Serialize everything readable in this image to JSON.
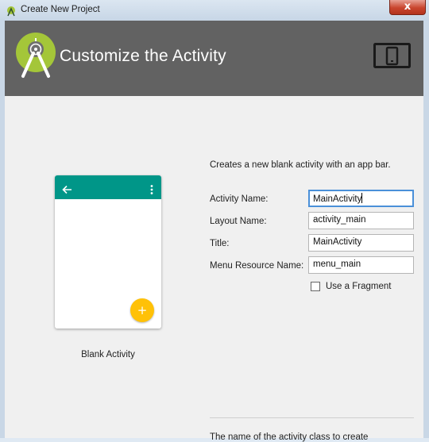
{
  "window": {
    "title": "Create New Project",
    "close_label": "x"
  },
  "header": {
    "title": "Customize the Activity",
    "brand_color": "#a4c639",
    "header_color": "#626262"
  },
  "preview": {
    "template_name": "Blank Activity",
    "appbar_color": "#009688",
    "fab_color": "#ffc107",
    "fab_label": "+"
  },
  "form": {
    "description": "Creates a new blank activity with an app bar.",
    "fields": [
      {
        "label": "Activity Name:",
        "value": "MainActivity"
      },
      {
        "label": "Layout Name:",
        "value": "activity_main"
      },
      {
        "label": "Title:",
        "value": "MainActivity"
      },
      {
        "label": "Menu Resource Name:",
        "value": "menu_main"
      }
    ],
    "fragment_checkbox": {
      "label": "Use a Fragment",
      "checked": false
    },
    "help_text": "The name of the activity class to create"
  }
}
